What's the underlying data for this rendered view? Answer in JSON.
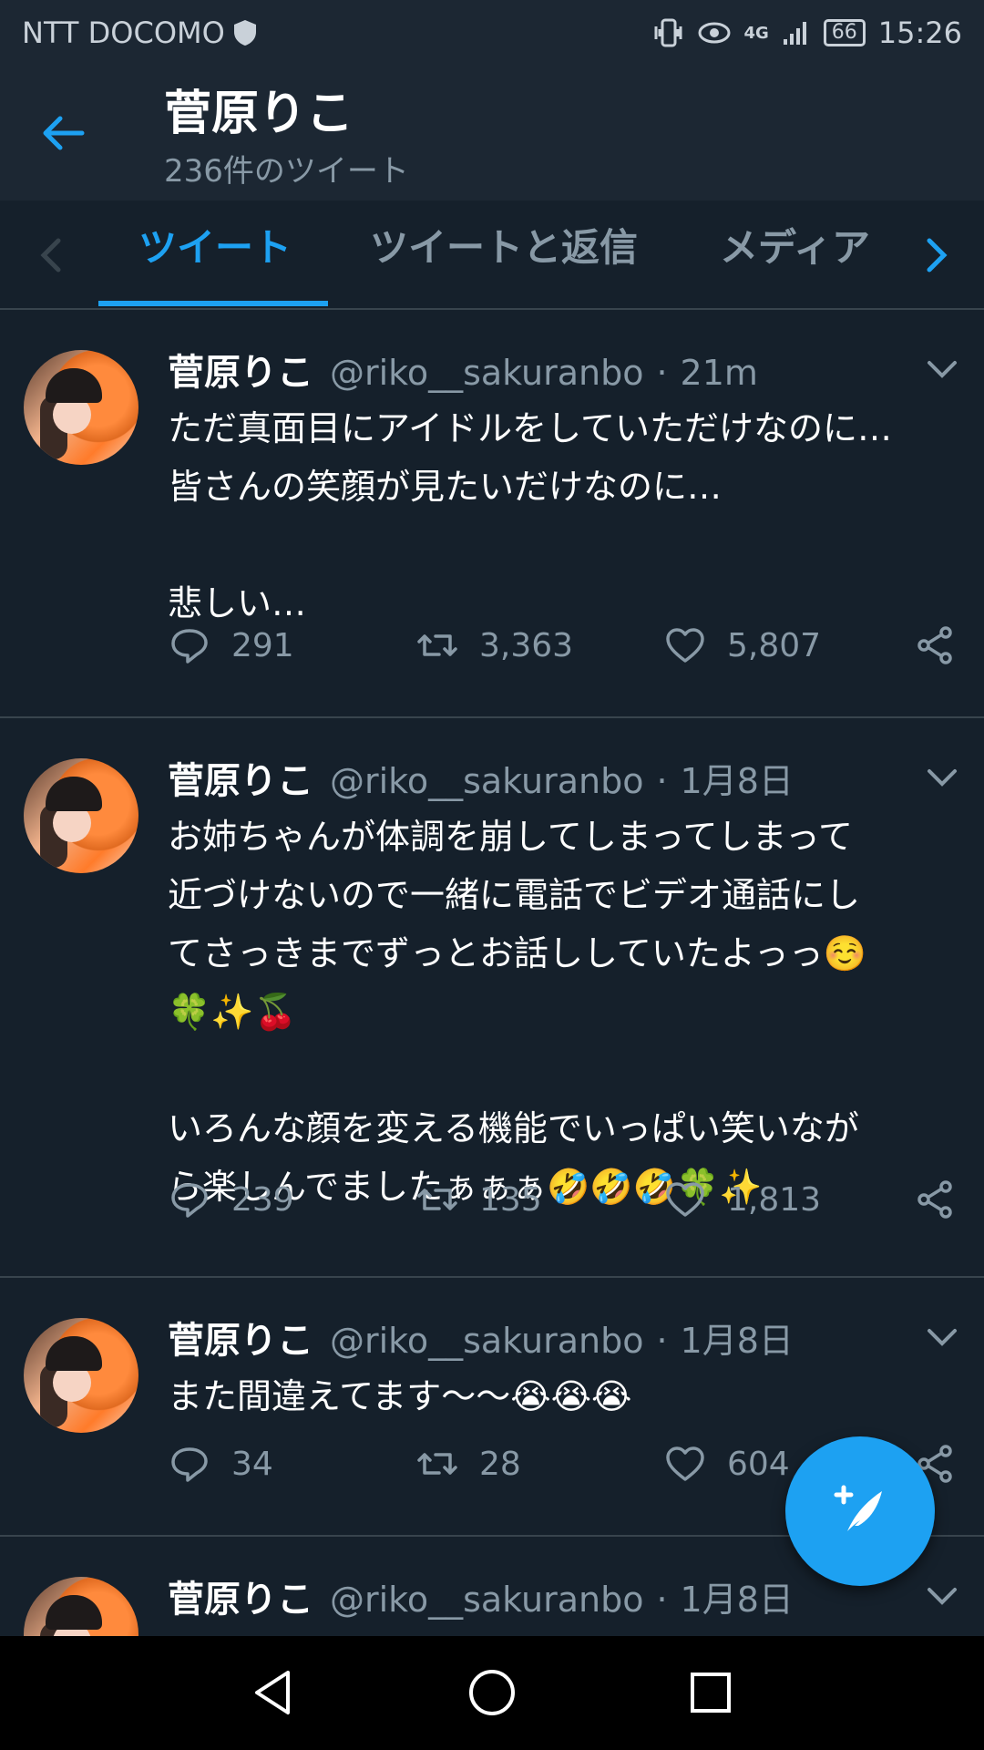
{
  "status_bar": {
    "carrier": "NTT DOCOMO",
    "network": "4G",
    "battery": "66",
    "time": "15:26"
  },
  "header": {
    "title": "菅原りこ",
    "subtitle": "236件のツイート"
  },
  "tabs": [
    {
      "label": "ツイート",
      "active": true
    },
    {
      "label": "ツイートと返信",
      "active": false
    },
    {
      "label": "メディア",
      "active": false
    }
  ],
  "tweets": [
    {
      "name": "菅原りこ",
      "handle": "@riko__sakuranbo",
      "separator": "·",
      "time": "21m",
      "text": "ただ真面目にアイドルをしていただけなのに…\n皆さんの笑顔が見たいだけなのに…\n\n悲しい…",
      "replies": "291",
      "retweets": "3,363",
      "likes": "5,807"
    },
    {
      "name": "菅原りこ",
      "handle": "@riko__sakuranbo",
      "separator": "·",
      "time": "1月8日",
      "text": "お姉ちゃんが体調を崩してしまってしまって\n近づけないので一緒に電話でビデオ通話にし\nてさっきまでずっとお話ししていたよっっ☺️\n🍀✨🍒\n\nいろんな顔を変える機能でいっぱい笑いなが\nら楽しんでましたぁぁぁ🤣🤣🤣🍀✨",
      "replies": "239",
      "retweets": "135",
      "likes": "1,813"
    },
    {
      "name": "菅原りこ",
      "handle": "@riko__sakuranbo",
      "separator": "·",
      "time": "1月8日",
      "text": "また間違えてます〜〜😭😭😭",
      "replies": "34",
      "retweets": "28",
      "likes": "604"
    },
    {
      "name": "菅原りこ",
      "handle": "@riko__sakuranbo",
      "separator": "·",
      "time": "1月8日",
      "text": "",
      "replies": "",
      "retweets": "",
      "likes": ""
    }
  ],
  "colors": {
    "background": "#15202b",
    "header": "#1c2733",
    "accent": "#1da1f2",
    "muted": "#8899a6",
    "divider": "#38444d"
  },
  "icons": [
    "back-arrow-icon",
    "reply-icon",
    "retweet-icon",
    "like-icon",
    "share-icon",
    "compose-icon",
    "nav-back-icon",
    "nav-home-icon",
    "nav-recents-icon"
  ]
}
